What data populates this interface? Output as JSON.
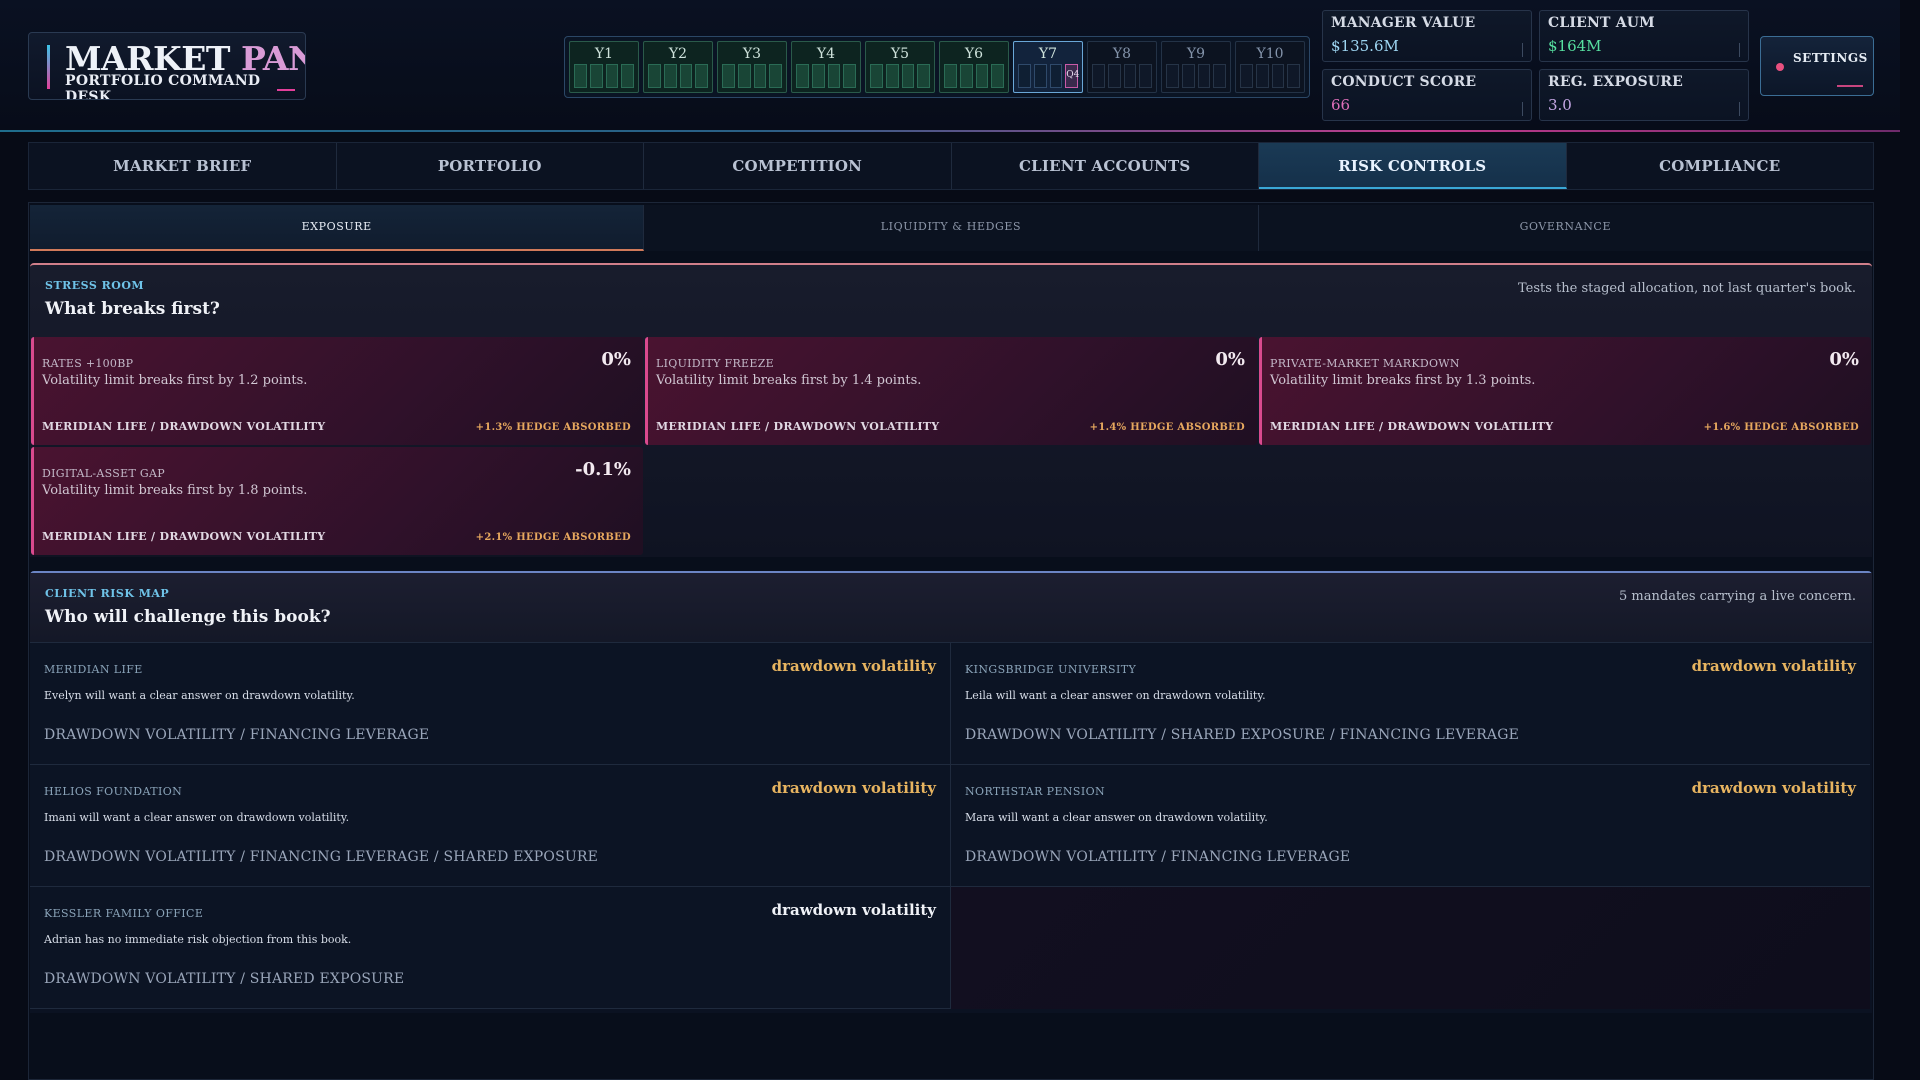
{
  "app": {
    "title_word1": "MARKET",
    "title_word2": "PANIC",
    "subtitle": "PORTFOLIO COMMAND DESK"
  },
  "timeline": {
    "years": [
      "Y1",
      "Y2",
      "Y3",
      "Y4",
      "Y5",
      "Y6",
      "Y7",
      "Y8",
      "Y9",
      "Y10"
    ],
    "current_year": "Y7",
    "current_quarter_label": "Q4",
    "completed_years": 6,
    "current_year_quarter_index": 3
  },
  "stats": {
    "manager_value": {
      "label": "MANAGER VALUE",
      "value": "$135.6M"
    },
    "client_aum": {
      "label": "CLIENT AUM",
      "value": "$164M"
    },
    "conduct_score": {
      "label": "CONDUCT SCORE",
      "value": "66"
    },
    "reg_exposure": {
      "label": "REG. EXPOSURE",
      "value": "3.0"
    }
  },
  "settings": {
    "label": "SETTINGS"
  },
  "main_tabs": [
    {
      "label": "MARKET BRIEF"
    },
    {
      "label": "PORTFOLIO"
    },
    {
      "label": "COMPETITION"
    },
    {
      "label": "CLIENT ACCOUNTS"
    },
    {
      "label": "RISK CONTROLS",
      "active": true
    },
    {
      "label": "COMPLIANCE"
    }
  ],
  "sub_tabs": [
    {
      "label": "EXPOSURE",
      "active": true
    },
    {
      "label": "LIQUIDITY & HEDGES"
    },
    {
      "label": "GOVERNANCE"
    }
  ],
  "stress_room": {
    "kicker": "STRESS ROOM",
    "title": "What breaks first?",
    "note": "Tests the staged allocation, not last quarter's book.",
    "cards": [
      {
        "name": "RATES +100BP",
        "value": "0%",
        "desc": "Volatility limit breaks first by 1.2 points.",
        "footer": "MERIDIAN LIFE / DRAWDOWN VOLATILITY",
        "hedge": "+1.3% HEDGE ABSORBED"
      },
      {
        "name": "LIQUIDITY FREEZE",
        "value": "0%",
        "desc": "Volatility limit breaks first by 1.4 points.",
        "footer": "MERIDIAN LIFE / DRAWDOWN VOLATILITY",
        "hedge": "+1.4% HEDGE ABSORBED"
      },
      {
        "name": "PRIVATE-MARKET MARKDOWN",
        "value": "0%",
        "desc": "Volatility limit breaks first by 1.3 points.",
        "footer": "MERIDIAN LIFE / DRAWDOWN VOLATILITY",
        "hedge": "+1.6% HEDGE ABSORBED"
      },
      {
        "name": "DIGITAL-ASSET GAP",
        "value": "-0.1%",
        "desc": "Volatility limit breaks first by 1.8 points.",
        "footer": "MERIDIAN LIFE / DRAWDOWN VOLATILITY",
        "hedge": "+2.1% HEDGE ABSORBED"
      }
    ]
  },
  "client_risk_map": {
    "kicker": "CLIENT RISK MAP",
    "title": "Who will challenge this book?",
    "note": "5 mandates carrying a live concern.",
    "clients": [
      {
        "name": "MERIDIAN LIFE",
        "concern": "drawdown volatility",
        "desc": "Evelyn will want a clear answer on drawdown volatility.",
        "tags": "DRAWDOWN VOLATILITY / FINANCING LEVERAGE"
      },
      {
        "name": "KINGSBRIDGE UNIVERSITY",
        "concern": "drawdown volatility",
        "desc": "Leila will want a clear answer on drawdown volatility.",
        "tags": "DRAWDOWN VOLATILITY / SHARED EXPOSURE / FINANCING LEVERAGE"
      },
      {
        "name": "HELIOS FOUNDATION",
        "concern": "drawdown volatility",
        "desc": "Imani will want a clear answer on drawdown volatility.",
        "tags": "DRAWDOWN VOLATILITY / FINANCING LEVERAGE / SHARED EXPOSURE"
      },
      {
        "name": "NORTHSTAR PENSION",
        "concern": "drawdown volatility",
        "desc": "Mara will want a clear answer on drawdown volatility.",
        "tags": "DRAWDOWN VOLATILITY / FINANCING LEVERAGE"
      },
      {
        "name": "KESSLER FAMILY OFFICE",
        "concern": "drawdown volatility",
        "desc": "Adrian has no immediate risk objection from this book.",
        "tags": "DRAWDOWN VOLATILITY / SHARED EXPOSURE"
      }
    ]
  },
  "colors": {
    "accent_cyan": "#3aa7d6",
    "accent_pink": "#d94a8e",
    "hedge_amber": "#e7a85e",
    "concern_gold": "#e7b460"
  }
}
